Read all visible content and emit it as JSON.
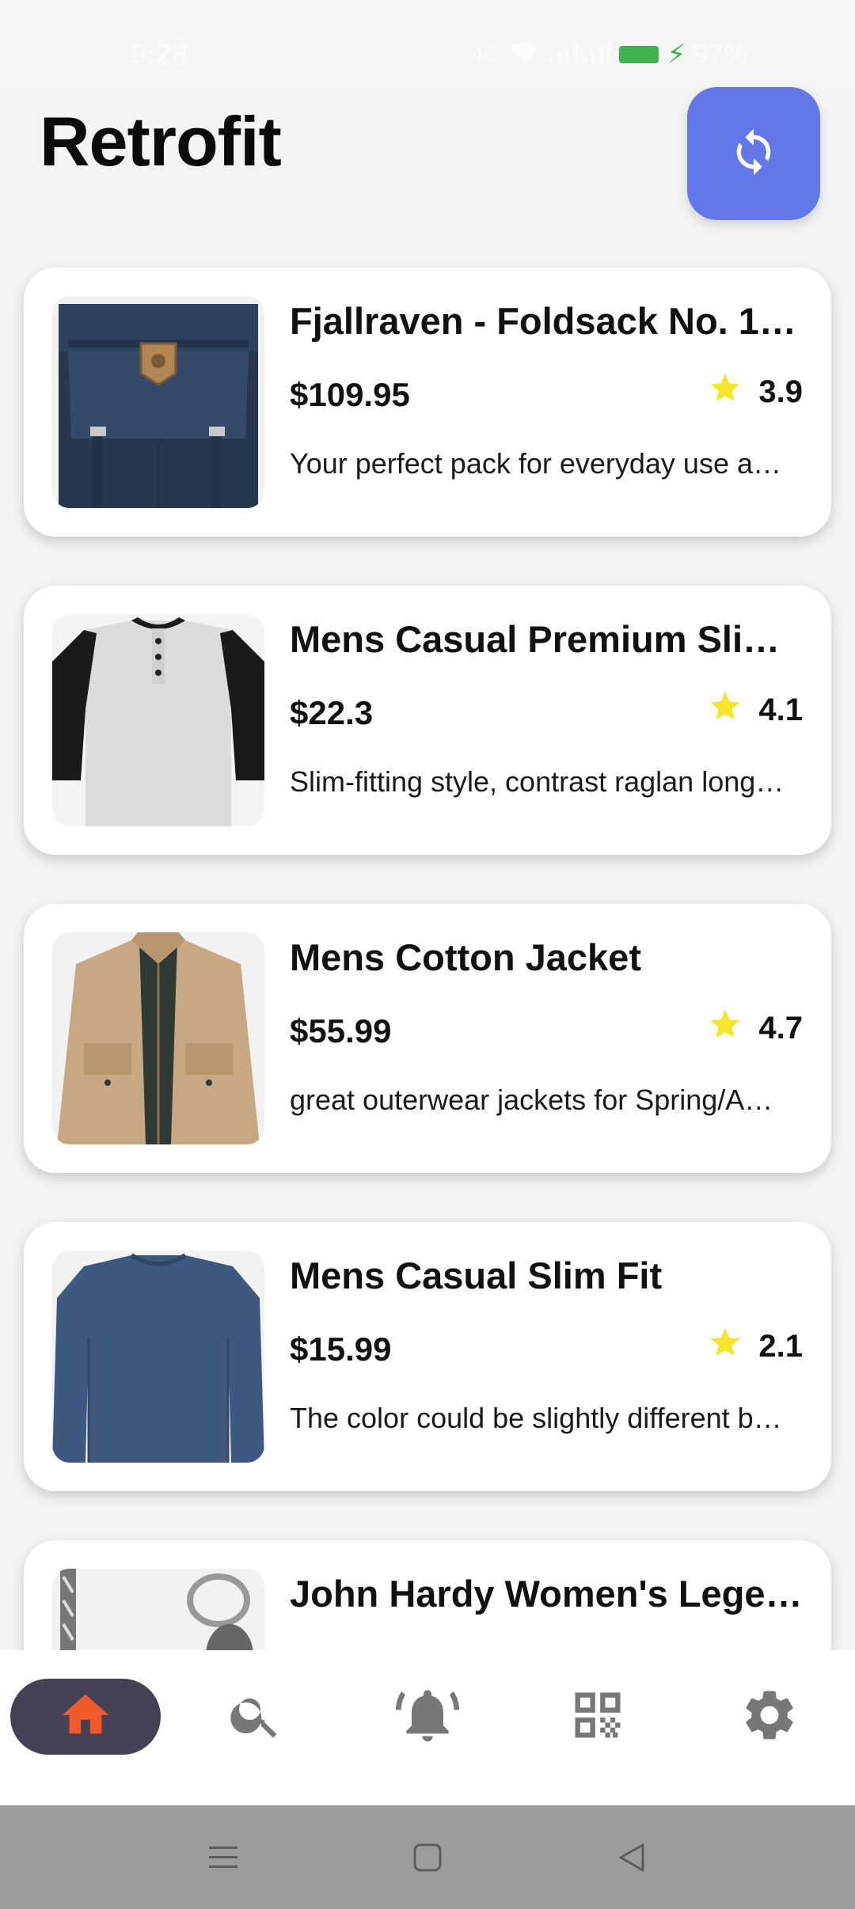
{
  "status_bar": {
    "time": "9:28",
    "signal_text": "4G",
    "battery_pct": "97%"
  },
  "header": {
    "title": "Retrofit",
    "refresh_icon": "refresh-icon",
    "accent_color": "#6277e8"
  },
  "products": [
    {
      "title": "Fjallraven - Foldsack No. 1 …",
      "price": "$109.95",
      "rating": "3.9",
      "description": "Your perfect pack for everyday use a…",
      "image": "backpack-image"
    },
    {
      "title": "Mens Casual Premium Slim…",
      "price": "$22.3",
      "rating": "4.1",
      "description": "Slim-fitting style, contrast raglan long…",
      "image": "tshirt-image"
    },
    {
      "title": "Mens Cotton Jacket",
      "price": "$55.99",
      "rating": "4.7",
      "description": "great outerwear jackets for Spring/A…",
      "image": "jacket-image"
    },
    {
      "title": "Mens Casual Slim Fit",
      "price": "$15.99",
      "rating": "2.1",
      "description": "The color could be slightly different b…",
      "image": "longsleeve-image"
    },
    {
      "title": "John Hardy Women's Legen…",
      "price": "",
      "rating": "",
      "description": "",
      "image": "bracelet-image"
    }
  ],
  "bottom_nav": {
    "items": [
      {
        "icon": "home-icon",
        "active": true
      },
      {
        "icon": "search-icon",
        "active": false
      },
      {
        "icon": "bell-icon",
        "active": false
      },
      {
        "icon": "qr-code-icon",
        "active": false
      },
      {
        "icon": "settings-icon",
        "active": false
      }
    ],
    "active_color": "#454256",
    "home_icon_color": "#f0592a"
  },
  "system_nav": {
    "buttons": [
      "menu-icon",
      "home-square-icon",
      "back-icon"
    ]
  },
  "colors": {
    "star": "#f5e52b",
    "background": "#f4f4f4"
  }
}
